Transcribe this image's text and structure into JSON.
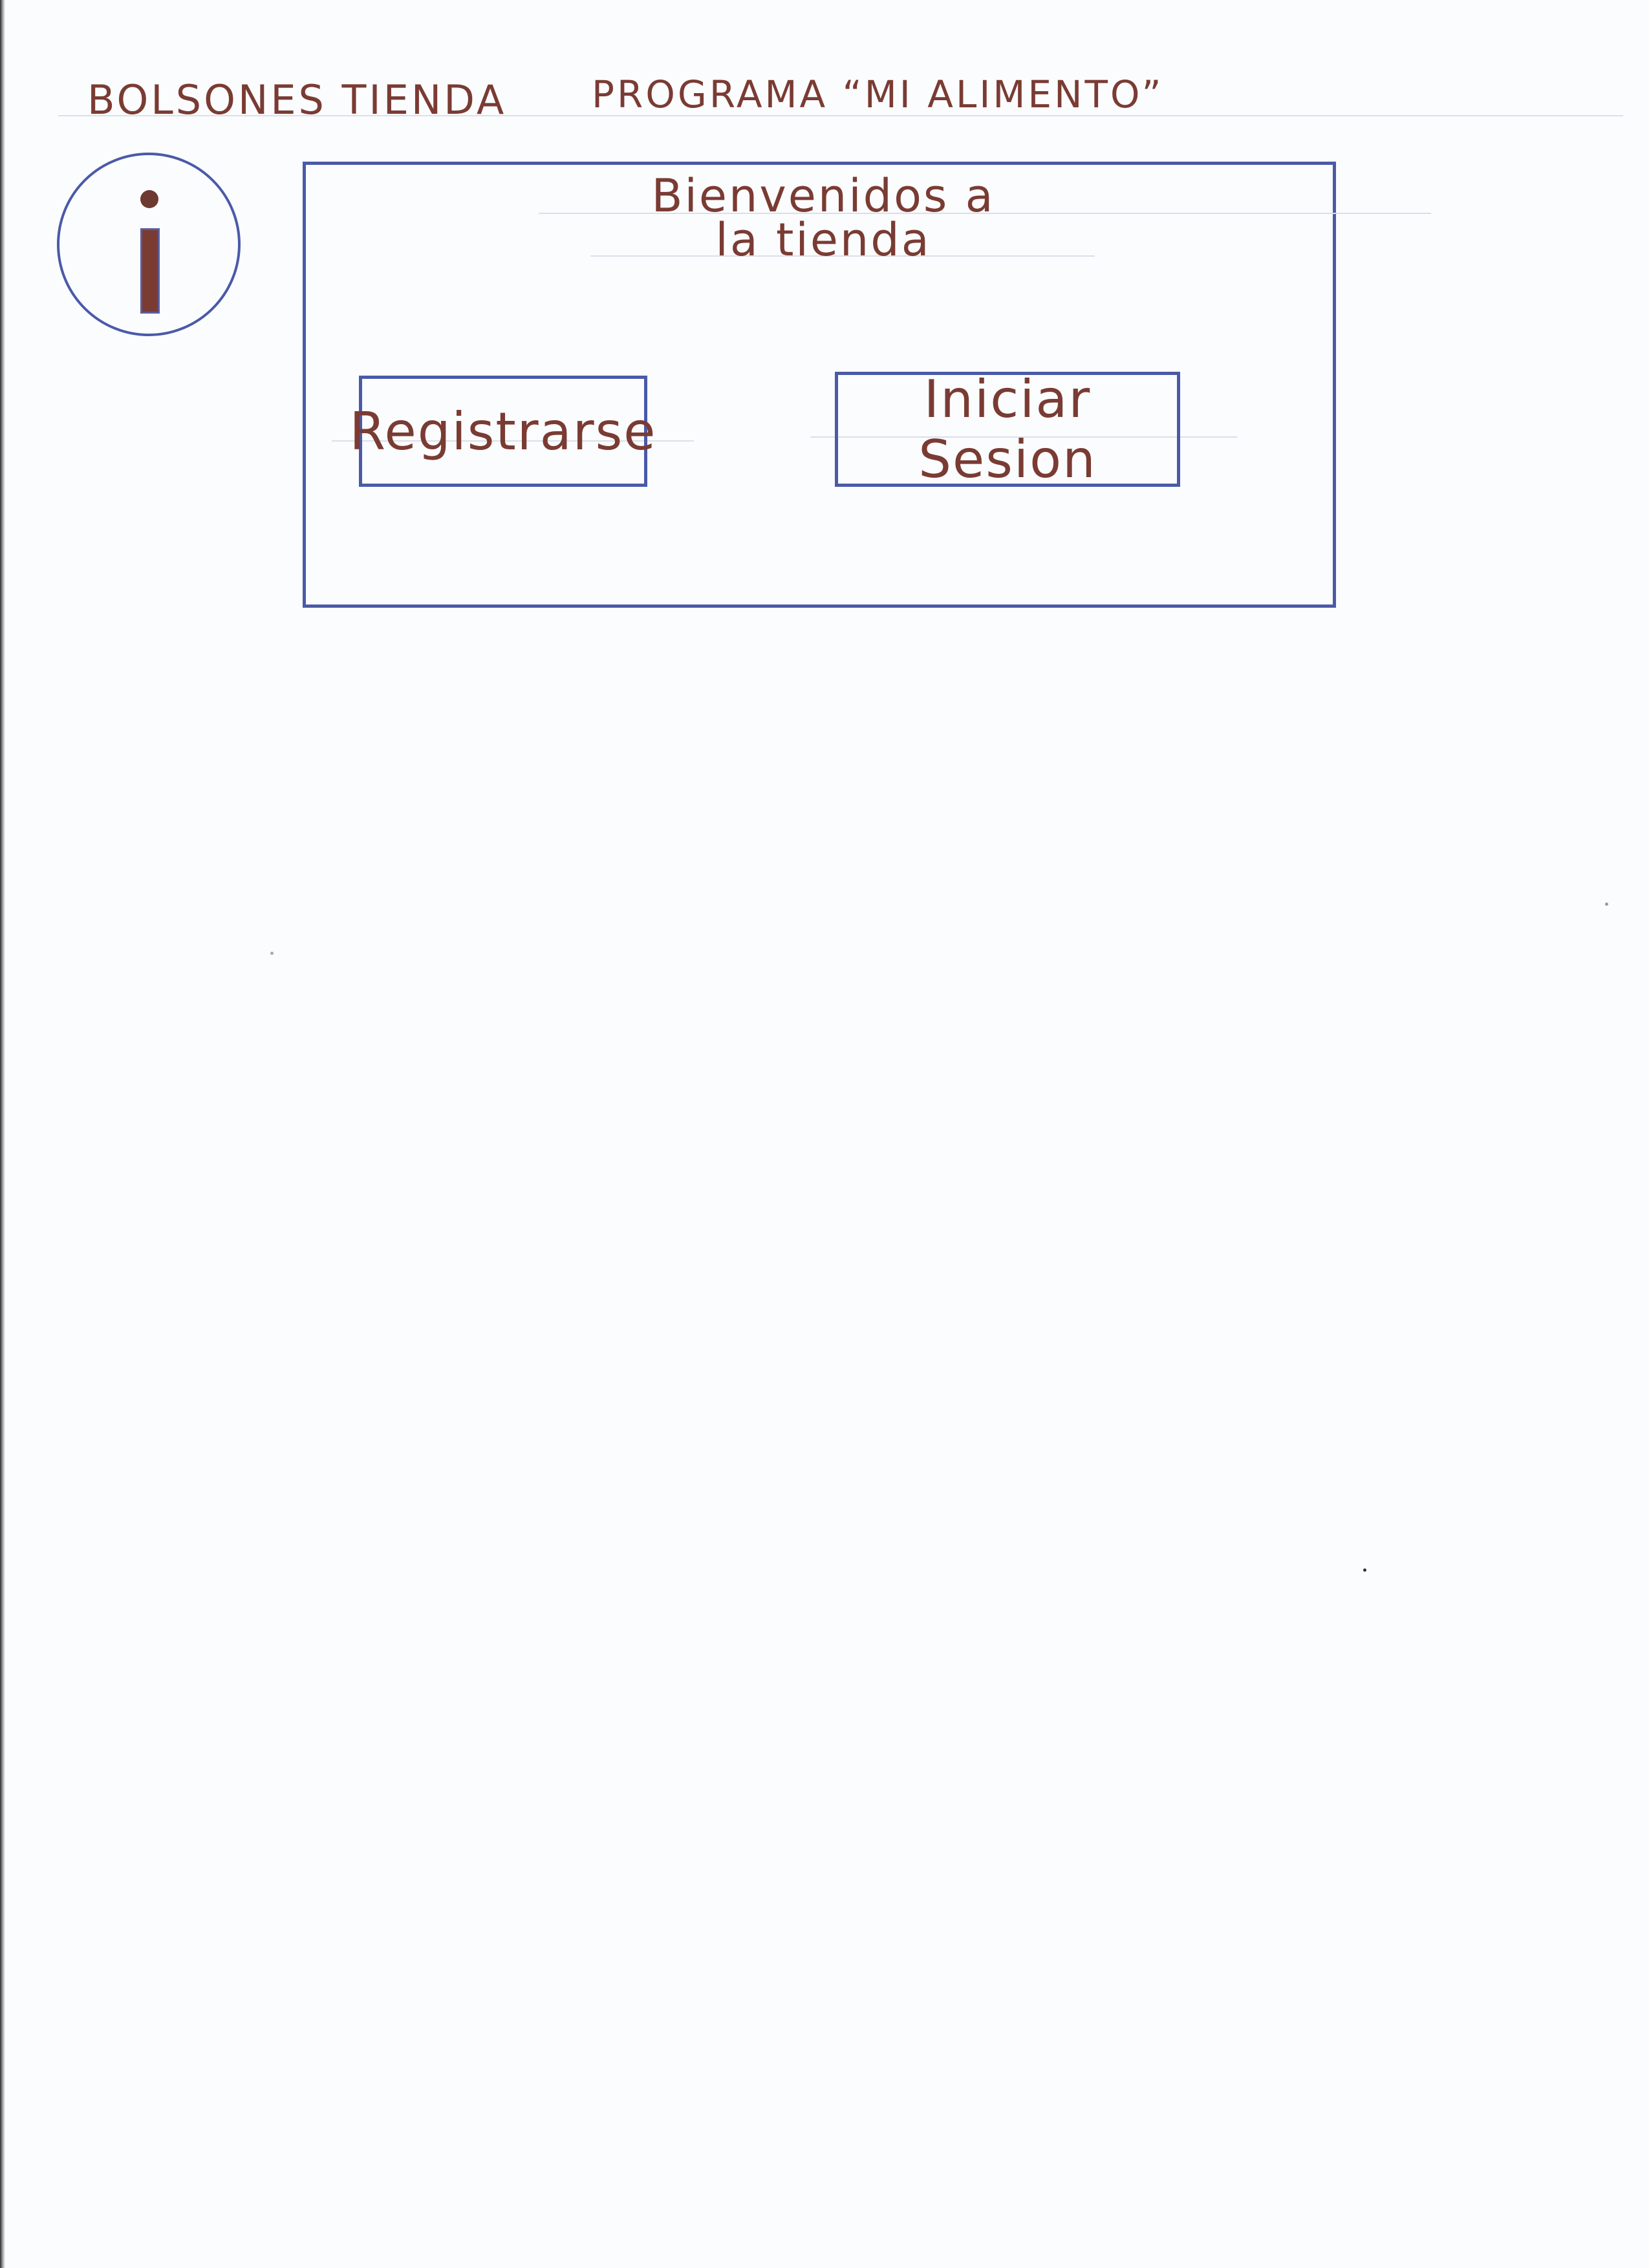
{
  "header": {
    "store_name": "BOLSONES TIENDA",
    "program_name": "PROGRAMA “MI ALIMENTO”"
  },
  "info_button": {
    "icon": "info-icon"
  },
  "welcome": {
    "line1": "Bienvenidos a",
    "line2": "la tienda"
  },
  "actions": {
    "register_label": "Registrarse",
    "login_label": "Iniciar Sesion"
  },
  "colors": {
    "ink_text": "#7a3b33",
    "ink_border": "#4a5aa8",
    "paper": "#fbfcfe"
  }
}
